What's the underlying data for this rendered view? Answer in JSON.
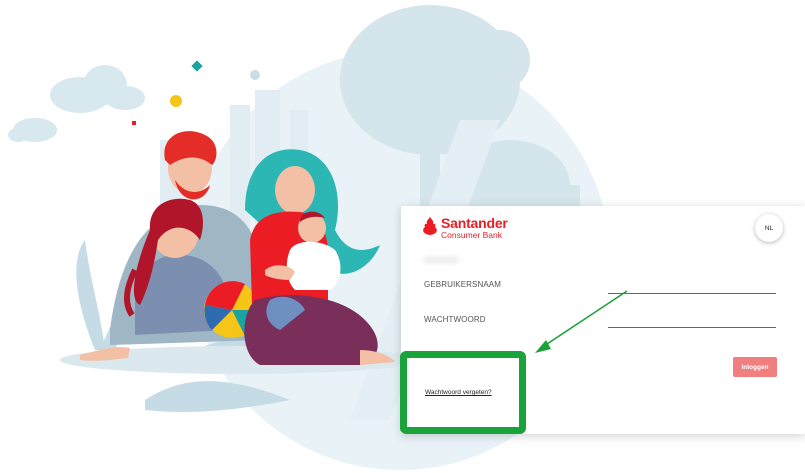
{
  "brand": {
    "name": "Santander",
    "subtitle": "Consumer Bank",
    "color": "#ec1c24"
  },
  "language": {
    "label": "NL"
  },
  "form": {
    "username_label": "GEBRUIKERSNAAM",
    "username_value": "",
    "password_label": "WACHTWOORD",
    "password_value": "",
    "login_label": "Inloggen",
    "forgot_password_label": "Wachtwoord vergeten?"
  },
  "annotation": {
    "highlight_color": "#1aa33a",
    "arrow_color": "#1aa33a"
  },
  "icons": [
    "santander-flame-icon"
  ],
  "illustration": "family-illustration"
}
